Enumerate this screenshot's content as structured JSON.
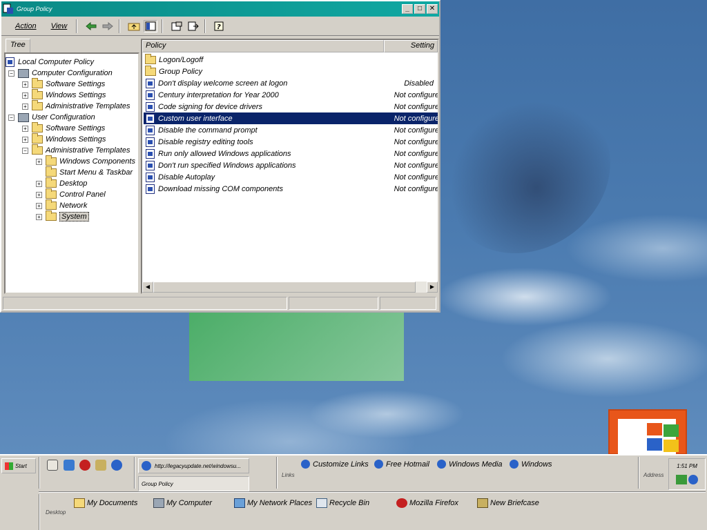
{
  "window": {
    "title": "Group Policy",
    "menu": {
      "action": "Action",
      "view": "View"
    },
    "tab": "Tree",
    "tree": [
      {
        "label": "Local Computer Policy",
        "level": 0,
        "icon": "policy-doc-icon",
        "expander": ""
      },
      {
        "label": "Computer Configuration",
        "level": 1,
        "icon": "computer-icon",
        "expander": "−"
      },
      {
        "label": "Software Settings",
        "level": 2,
        "icon": "folder-icon",
        "expander": "+"
      },
      {
        "label": "Windows Settings",
        "level": 2,
        "icon": "folder-icon",
        "expander": "+"
      },
      {
        "label": "Administrative Templates",
        "level": 2,
        "icon": "folder-icon",
        "expander": "+"
      },
      {
        "label": "User Configuration",
        "level": 1,
        "icon": "user-config-icon",
        "expander": "−"
      },
      {
        "label": "Software Settings",
        "level": 2,
        "icon": "folder-icon",
        "expander": "+"
      },
      {
        "label": "Windows Settings",
        "level": 2,
        "icon": "folder-icon",
        "expander": "+"
      },
      {
        "label": "Administrative Templates",
        "level": 2,
        "icon": "folder-icon",
        "expander": "−"
      },
      {
        "label": "Windows Components",
        "level": 3,
        "icon": "folder-icon",
        "expander": "+"
      },
      {
        "label": "Start Menu & Taskbar",
        "level": 3,
        "icon": "folder-icon",
        "expander": ""
      },
      {
        "label": "Desktop",
        "level": 3,
        "icon": "folder-icon",
        "expander": "+"
      },
      {
        "label": "Control Panel",
        "level": 3,
        "icon": "folder-icon",
        "expander": "+"
      },
      {
        "label": "Network",
        "level": 3,
        "icon": "folder-icon",
        "expander": "+"
      },
      {
        "label": "System",
        "level": 3,
        "icon": "folder-open-icon",
        "expander": "+",
        "selected": true
      }
    ],
    "columns": {
      "policy": "Policy",
      "setting": "Setting"
    },
    "policies": [
      {
        "name": "Logon/Logoff",
        "setting": "",
        "icon": "folder-icon"
      },
      {
        "name": "Group Policy",
        "setting": "",
        "icon": "folder-icon"
      },
      {
        "name": "Don't display welcome screen at logon",
        "setting": "Disabled",
        "icon": "policy-icon"
      },
      {
        "name": "Century interpretation for Year 2000",
        "setting": "Not configure",
        "icon": "policy-icon"
      },
      {
        "name": "Code signing for device drivers",
        "setting": "Not configure",
        "icon": "policy-icon"
      },
      {
        "name": "Custom user interface",
        "setting": "Not configure",
        "icon": "policy-icon",
        "selected": true
      },
      {
        "name": "Disable the command prompt",
        "setting": "Not configure",
        "icon": "policy-icon"
      },
      {
        "name": "Disable registry editing tools",
        "setting": "Not configure",
        "icon": "policy-icon"
      },
      {
        "name": "Run only allowed Windows applications",
        "setting": "Not configure",
        "icon": "policy-icon"
      },
      {
        "name": "Don't run specified Windows applications",
        "setting": "Not configure",
        "icon": "policy-icon"
      },
      {
        "name": "Disable Autoplay",
        "setting": "Not configure",
        "icon": "policy-icon"
      },
      {
        "name": "Download missing COM components",
        "setting": "Not configure",
        "icon": "policy-icon"
      }
    ]
  },
  "taskbar": {
    "start": "Start",
    "tasks": [
      {
        "label": "http://legacyupdate.net/windowsu...",
        "active": false
      },
      {
        "label": "Group Policy",
        "active": true
      }
    ],
    "links_label": "Links",
    "links": [
      "Customize Links",
      "Free Hotmail",
      "Windows Media",
      "Windows"
    ],
    "address_label": "Address",
    "desktop_label": "Desktop",
    "desktop_items": [
      "My Documents",
      "My Computer",
      "My Network Places",
      "Recycle Bin",
      "Mozilla Firefox",
      "New Briefcase"
    ],
    "clock": "1:51 PM"
  },
  "colors": {
    "titlebar": "#0a8a86",
    "selection": "#0a246a",
    "desktop": "#3f6ea3"
  }
}
